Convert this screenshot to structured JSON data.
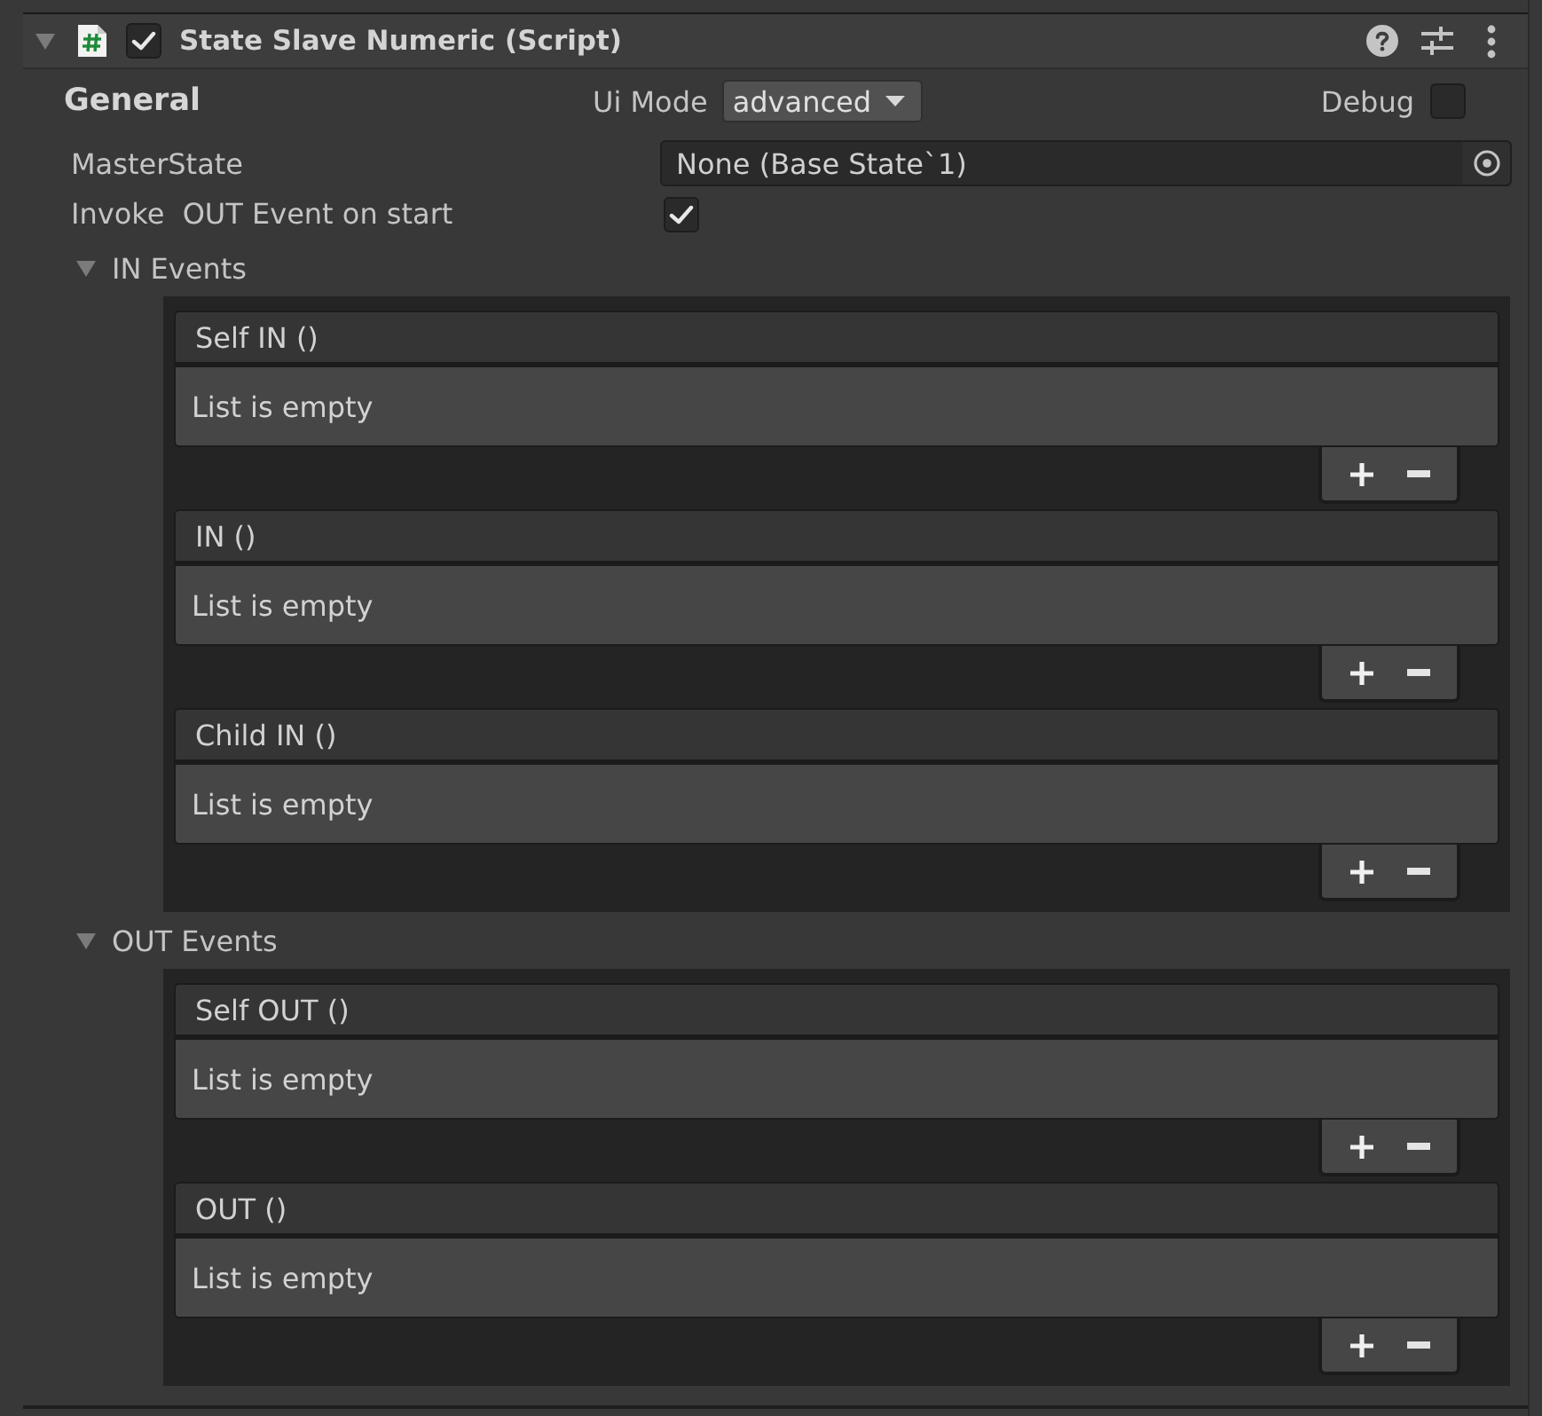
{
  "component": {
    "title": "State Slave Numeric (Script)",
    "expanded": true,
    "enabled": true
  },
  "general": {
    "heading": "General",
    "ui_mode": {
      "label": "Ui Mode",
      "value": "advanced"
    },
    "debug": {
      "label": "Debug",
      "checked": false
    }
  },
  "fields": [
    {
      "kind": "object",
      "label": "MasterState",
      "value": "None (Base State`1)"
    },
    {
      "kind": "toggle",
      "label": "Invoke  OUT Event on start",
      "checked": true
    }
  ],
  "event_groups": [
    {
      "label": "IN Events",
      "expanded": true,
      "events": [
        {
          "title": "Self IN ()",
          "empty_message": "List is empty"
        },
        {
          "title": "IN ()",
          "empty_message": "List is empty"
        },
        {
          "title": "Child IN ()",
          "empty_message": "List is empty"
        }
      ]
    },
    {
      "label": "OUT Events",
      "expanded": true,
      "events": [
        {
          "title": "Self OUT ()",
          "empty_message": "List is empty"
        },
        {
          "title": "OUT ()",
          "empty_message": "List is empty"
        }
      ]
    }
  ]
}
